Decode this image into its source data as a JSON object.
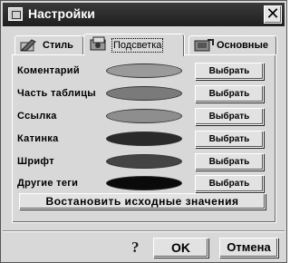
{
  "window": {
    "title": "Настройки",
    "close_glyph": "✕"
  },
  "tabs": [
    {
      "label": "Стиль",
      "icon": "style-icon",
      "active": false
    },
    {
      "label": "Подсветка",
      "icon": "highlight-icon",
      "active": true
    },
    {
      "label": "Основные",
      "icon": "general-icon",
      "active": false
    }
  ],
  "rows": [
    {
      "label": "Коментарий",
      "color": "#9a9a9a",
      "button": "Выбрать"
    },
    {
      "label": "Часть таблицы",
      "color": "#7a7a7a",
      "button": "Выбрать"
    },
    {
      "label": "Ссылка",
      "color": "#8e8e8e",
      "button": "Выбрать"
    },
    {
      "label": "Катинка",
      "color": "#2a2a2a",
      "button": "Выбрать"
    },
    {
      "label": "Шрифт",
      "color": "#444444",
      "button": "Выбрать"
    },
    {
      "label": "Другие теги",
      "color": "#0a0a0a",
      "button": "Выбрать"
    }
  ],
  "reset_button": "Востановить исходные значения",
  "footer": {
    "help_glyph": "?",
    "ok": "OK",
    "cancel": "Отмена"
  }
}
